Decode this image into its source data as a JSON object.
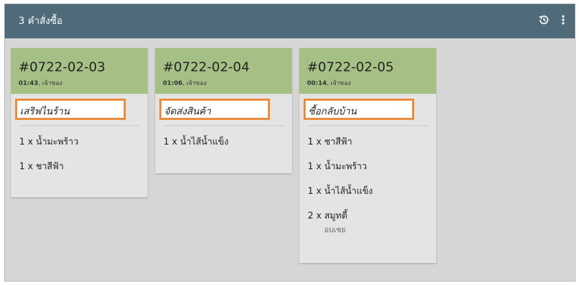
{
  "topbar": {
    "title": "3 คำสั่งซื้อ",
    "history_icon": "history-icon",
    "menu_icon": "more-vert-icon",
    "background": "#4f6a78"
  },
  "orders": [
    {
      "id": "#0722-02-03",
      "time": "01:43",
      "owner": "เจ้าของ",
      "type": "เสริฟไนร้าน",
      "items": [
        {
          "qty": "1 x",
          "name": "น้ำมะพร้าว"
        },
        {
          "qty": "1 x",
          "name": "ชาสีฟ้า"
        }
      ]
    },
    {
      "id": "#0722-02-04",
      "time": "01:06",
      "owner": "เจ้าของ",
      "type": "จัดส่งสินค้า",
      "items": [
        {
          "qty": "1 x",
          "name": "น้ำไส้น้ำแข็ง"
        }
      ]
    },
    {
      "id": "#0722-02-05",
      "time": "00:14",
      "owner": "เจ้าของ",
      "type": "ซื้อกลับบ้าน",
      "items": [
        {
          "qty": "1 x",
          "name": "ชาสีฟ้า"
        },
        {
          "qty": "1 x",
          "name": "น้ำมะพร้าว"
        },
        {
          "qty": "1 x",
          "name": "น้ำไส้น้ำแข็ง"
        },
        {
          "qty": "2 x",
          "name": "สมูทตี้",
          "note": "อบเชย"
        }
      ]
    }
  ],
  "colors": {
    "card_header": "#a5c085",
    "highlight_border": "#e98a38",
    "canvas": "#d6d6d6"
  }
}
